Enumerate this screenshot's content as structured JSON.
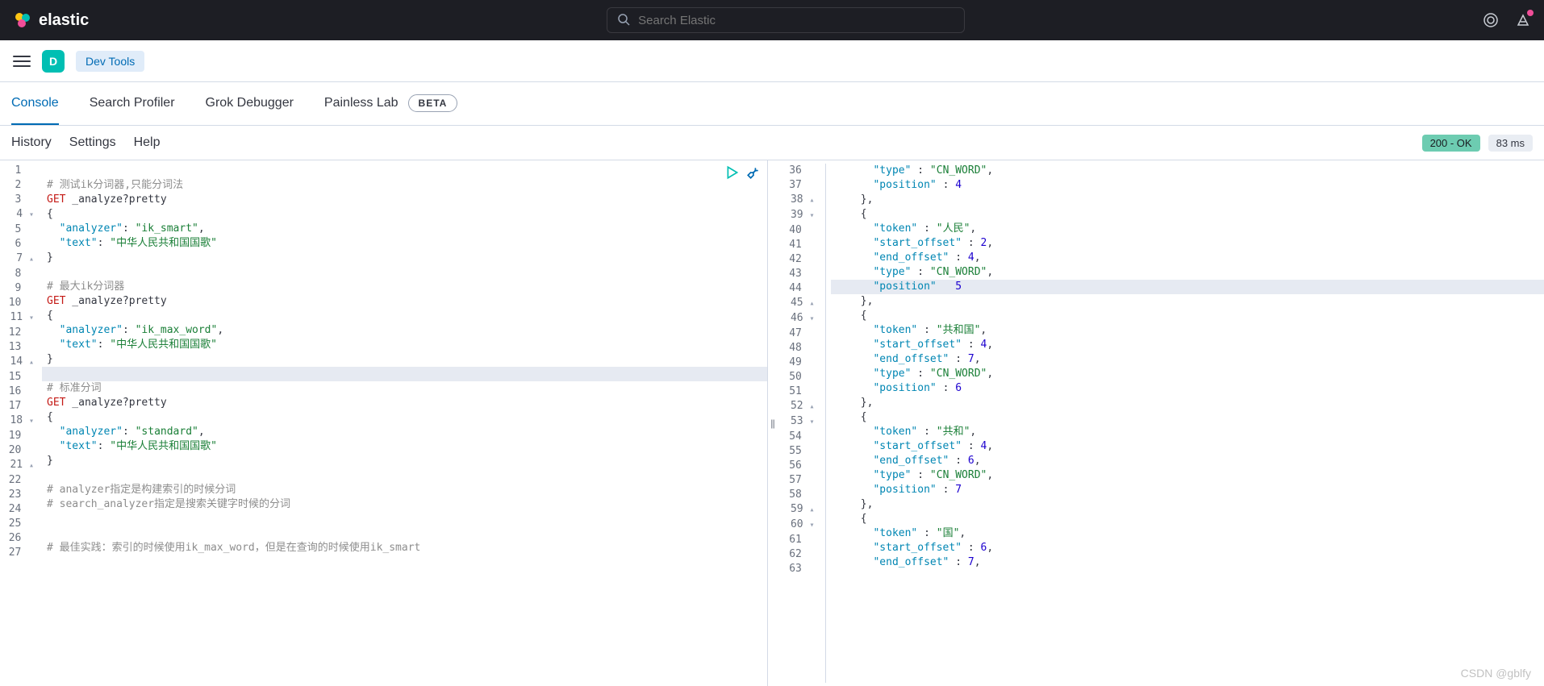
{
  "header": {
    "brand": "elastic",
    "search_placeholder": "Search Elastic"
  },
  "breadcrumb": {
    "space_initial": "D",
    "devtools_label": "Dev Tools"
  },
  "tabs": {
    "console": "Console",
    "profiler": "Search Profiler",
    "grok": "Grok Debugger",
    "painless": "Painless Lab",
    "beta": "BETA"
  },
  "toolbar": {
    "history": "History",
    "settings": "Settings",
    "help": "Help"
  },
  "status": {
    "ok": "200 - OK",
    "ms": "83 ms"
  },
  "request_editor": {
    "first_line": 1,
    "last_line": 27,
    "highlighted_line": 15,
    "folds": {
      "4": "▾",
      "7": "▴",
      "11": "▾",
      "14": "▴",
      "18": "▾",
      "21": "▴"
    },
    "lines": {
      "1": {
        "raw": ""
      },
      "2": {
        "comment": "# 测试ik分词器,只能分词法"
      },
      "3": {
        "method": "GET",
        "path": " _analyze?pretty"
      },
      "4": {
        "raw": "{"
      },
      "5": {
        "segments": [
          [
            "p",
            "  "
          ],
          [
            "key",
            "\"analyzer\""
          ],
          [
            "p",
            ": "
          ],
          [
            "str",
            "\"ik_smart\""
          ],
          [
            "p",
            ","
          ]
        ]
      },
      "6": {
        "segments": [
          [
            "p",
            "  "
          ],
          [
            "key",
            "\"text\""
          ],
          [
            "p",
            ": "
          ],
          [
            "str",
            "\"中华人民共和国国歌\""
          ]
        ]
      },
      "7": {
        "raw": "}"
      },
      "8": {
        "raw": ""
      },
      "9": {
        "comment": "# 最大ik分词器"
      },
      "10": {
        "method": "GET",
        "path": " _analyze?pretty"
      },
      "11": {
        "raw": "{"
      },
      "12": {
        "segments": [
          [
            "p",
            "  "
          ],
          [
            "key",
            "\"analyzer\""
          ],
          [
            "p",
            ": "
          ],
          [
            "str",
            "\"ik_max_word\""
          ],
          [
            "p",
            ","
          ]
        ]
      },
      "13": {
        "segments": [
          [
            "p",
            "  "
          ],
          [
            "key",
            "\"text\""
          ],
          [
            "p",
            ": "
          ],
          [
            "str",
            "\"中华人民共和国国歌\""
          ]
        ]
      },
      "14": {
        "raw": "}"
      },
      "15": {
        "raw": ""
      },
      "16": {
        "comment": "# 标准分词"
      },
      "17": {
        "method": "GET",
        "path": " _analyze?pretty"
      },
      "18": {
        "raw": "{"
      },
      "19": {
        "segments": [
          [
            "p",
            "  "
          ],
          [
            "key",
            "\"analyzer\""
          ],
          [
            "p",
            ": "
          ],
          [
            "str",
            "\"standard\""
          ],
          [
            "p",
            ","
          ]
        ]
      },
      "20": {
        "segments": [
          [
            "p",
            "  "
          ],
          [
            "key",
            "\"text\""
          ],
          [
            "p",
            ": "
          ],
          [
            "str",
            "\"中华人民共和国国歌\""
          ]
        ]
      },
      "21": {
        "raw": "}"
      },
      "22": {
        "raw": ""
      },
      "23": {
        "comment": "# analyzer指定是构建索引的时候分词"
      },
      "24": {
        "comment": "# search_analyzer指定是搜索关键字时候的分词"
      },
      "25": {
        "raw": ""
      },
      "26": {
        "raw": ""
      },
      "27": {
        "comment": "# 最佳实践：索引的时候使用ik_max_word，但是在查询的时候使用ik_smart"
      }
    }
  },
  "response_editor": {
    "first_line": 36,
    "last_line": 63,
    "highlighted_line": 44,
    "folds": {
      "38": "▴",
      "39": "▾",
      "45": "▴",
      "46": "▾",
      "52": "▴",
      "53": "▾",
      "59": "▴",
      "60": "▾"
    },
    "lines": {
      "36": {
        "segments": [
          [
            "p",
            "      "
          ],
          [
            "key",
            "\"type\""
          ],
          [
            "p",
            " : "
          ],
          [
            "str",
            "\"CN_WORD\""
          ],
          [
            "p",
            ","
          ]
        ]
      },
      "37": {
        "segments": [
          [
            "p",
            "      "
          ],
          [
            "key",
            "\"position\""
          ],
          [
            "p",
            " : "
          ],
          [
            "num",
            "4"
          ]
        ]
      },
      "38": {
        "raw": "    },"
      },
      "39": {
        "raw": "    {"
      },
      "40": {
        "segments": [
          [
            "p",
            "      "
          ],
          [
            "key",
            "\"token\""
          ],
          [
            "p",
            " : "
          ],
          [
            "str",
            "\"人民\""
          ],
          [
            "p",
            ","
          ]
        ]
      },
      "41": {
        "segments": [
          [
            "p",
            "      "
          ],
          [
            "key",
            "\"start_offset\""
          ],
          [
            "p",
            " : "
          ],
          [
            "num",
            "2"
          ],
          [
            "p",
            ","
          ]
        ]
      },
      "42": {
        "segments": [
          [
            "p",
            "      "
          ],
          [
            "key",
            "\"end_offset\""
          ],
          [
            "p",
            " : "
          ],
          [
            "num",
            "4"
          ],
          [
            "p",
            ","
          ]
        ]
      },
      "43": {
        "segments": [
          [
            "p",
            "      "
          ],
          [
            "key",
            "\"type\""
          ],
          [
            "p",
            " : "
          ],
          [
            "str",
            "\"CN_WORD\""
          ],
          [
            "p",
            ","
          ]
        ]
      },
      "44": {
        "segments": [
          [
            "p",
            "      "
          ],
          [
            "key",
            "\"position\""
          ],
          [
            "p",
            " : "
          ],
          [
            "num",
            "5"
          ]
        ]
      },
      "45": {
        "raw": "    },"
      },
      "46": {
        "raw": "    {"
      },
      "47": {
        "segments": [
          [
            "p",
            "      "
          ],
          [
            "key",
            "\"token\""
          ],
          [
            "p",
            " : "
          ],
          [
            "str",
            "\"共和国\""
          ],
          [
            "p",
            ","
          ]
        ]
      },
      "48": {
        "segments": [
          [
            "p",
            "      "
          ],
          [
            "key",
            "\"start_offset\""
          ],
          [
            "p",
            " : "
          ],
          [
            "num",
            "4"
          ],
          [
            "p",
            ","
          ]
        ]
      },
      "49": {
        "segments": [
          [
            "p",
            "      "
          ],
          [
            "key",
            "\"end_offset\""
          ],
          [
            "p",
            " : "
          ],
          [
            "num",
            "7"
          ],
          [
            "p",
            ","
          ]
        ]
      },
      "50": {
        "segments": [
          [
            "p",
            "      "
          ],
          [
            "key",
            "\"type\""
          ],
          [
            "p",
            " : "
          ],
          [
            "str",
            "\"CN_WORD\""
          ],
          [
            "p",
            ","
          ]
        ]
      },
      "51": {
        "segments": [
          [
            "p",
            "      "
          ],
          [
            "key",
            "\"position\""
          ],
          [
            "p",
            " : "
          ],
          [
            "num",
            "6"
          ]
        ]
      },
      "52": {
        "raw": "    },"
      },
      "53": {
        "raw": "    {"
      },
      "54": {
        "segments": [
          [
            "p",
            "      "
          ],
          [
            "key",
            "\"token\""
          ],
          [
            "p",
            " : "
          ],
          [
            "str",
            "\"共和\""
          ],
          [
            "p",
            ","
          ]
        ]
      },
      "55": {
        "segments": [
          [
            "p",
            "      "
          ],
          [
            "key",
            "\"start_offset\""
          ],
          [
            "p",
            " : "
          ],
          [
            "num",
            "4"
          ],
          [
            "p",
            ","
          ]
        ]
      },
      "56": {
        "segments": [
          [
            "p",
            "      "
          ],
          [
            "key",
            "\"end_offset\""
          ],
          [
            "p",
            " : "
          ],
          [
            "num",
            "6"
          ],
          [
            "p",
            ","
          ]
        ]
      },
      "57": {
        "segments": [
          [
            "p",
            "      "
          ],
          [
            "key",
            "\"type\""
          ],
          [
            "p",
            " : "
          ],
          [
            "str",
            "\"CN_WORD\""
          ],
          [
            "p",
            ","
          ]
        ]
      },
      "58": {
        "segments": [
          [
            "p",
            "      "
          ],
          [
            "key",
            "\"position\""
          ],
          [
            "p",
            " : "
          ],
          [
            "num",
            "7"
          ]
        ]
      },
      "59": {
        "raw": "    },"
      },
      "60": {
        "raw": "    {"
      },
      "61": {
        "segments": [
          [
            "p",
            "      "
          ],
          [
            "key",
            "\"token\""
          ],
          [
            "p",
            " : "
          ],
          [
            "str",
            "\"国\""
          ],
          [
            "p",
            ","
          ]
        ]
      },
      "62": {
        "segments": [
          [
            "p",
            "      "
          ],
          [
            "key",
            "\"start_offset\""
          ],
          [
            "p",
            " : "
          ],
          [
            "num",
            "6"
          ],
          [
            "p",
            ","
          ]
        ]
      },
      "63": {
        "segments": [
          [
            "p",
            "      "
          ],
          [
            "key",
            "\"end_offset\""
          ],
          [
            "p",
            " : "
          ],
          [
            "num",
            "7"
          ],
          [
            "p",
            ","
          ]
        ]
      }
    }
  },
  "watermark": "CSDN @gblfy"
}
